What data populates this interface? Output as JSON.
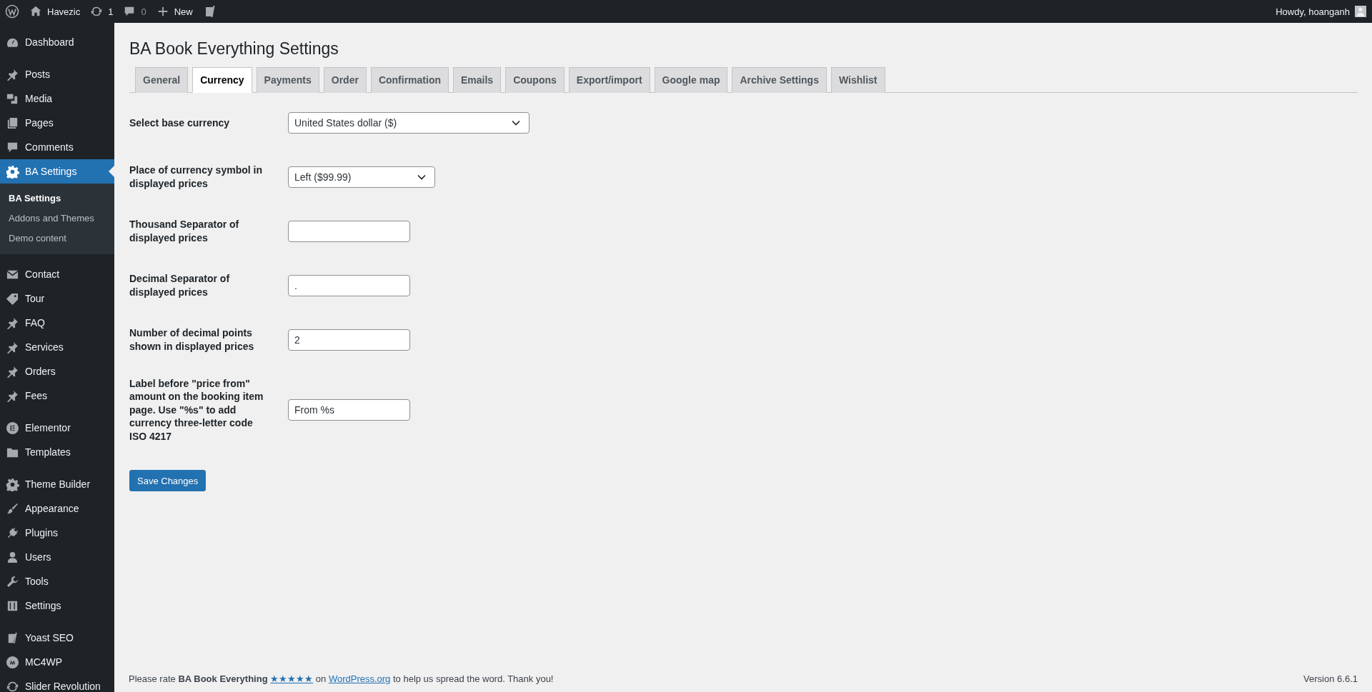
{
  "admin_bar": {
    "site_name": "Havezic",
    "updates": "1",
    "comments": "0",
    "new_label": "New",
    "greeting": "Howdy, hoanganh"
  },
  "sidebar": {
    "groups": [
      [
        {
          "label": "Dashboard",
          "selected": false
        }
      ],
      [
        {
          "label": "Posts",
          "selected": false
        },
        {
          "label": "Media",
          "selected": false
        },
        {
          "label": "Pages",
          "selected": false
        },
        {
          "label": "Comments",
          "selected": false
        },
        {
          "label": "BA Settings",
          "selected": true,
          "children": [
            {
              "label": "BA Settings",
              "selected": true
            },
            {
              "label": "Addons and Themes",
              "selected": false
            },
            {
              "label": "Demo content",
              "selected": false
            }
          ]
        }
      ],
      [
        {
          "label": "Contact",
          "selected": false
        },
        {
          "label": "Tour",
          "selected": false
        },
        {
          "label": "FAQ",
          "selected": false
        },
        {
          "label": "Services",
          "selected": false
        },
        {
          "label": "Orders",
          "selected": false
        },
        {
          "label": "Fees",
          "selected": false
        }
      ],
      [
        {
          "label": "Elementor",
          "selected": false
        },
        {
          "label": "Templates",
          "selected": false
        }
      ],
      [
        {
          "label": "Theme Builder",
          "selected": false
        },
        {
          "label": "Appearance",
          "selected": false
        },
        {
          "label": "Plugins",
          "selected": false
        },
        {
          "label": "Users",
          "selected": false
        },
        {
          "label": "Tools",
          "selected": false
        },
        {
          "label": "Settings",
          "selected": false
        }
      ],
      [
        {
          "label": "Yoast SEO",
          "selected": false
        },
        {
          "label": "MC4WP",
          "selected": false
        },
        {
          "label": "Slider Revolution",
          "selected": false
        }
      ]
    ]
  },
  "page": {
    "title": "BA Book Everything Settings",
    "tabs": [
      {
        "label": "General",
        "selected": false
      },
      {
        "label": "Currency",
        "selected": true
      },
      {
        "label": "Payments",
        "selected": false
      },
      {
        "label": "Order",
        "selected": false
      },
      {
        "label": "Confirmation",
        "selected": false
      },
      {
        "label": "Emails",
        "selected": false
      },
      {
        "label": "Coupons",
        "selected": false
      },
      {
        "label": "Export/import",
        "selected": false
      },
      {
        "label": "Google map",
        "selected": false
      },
      {
        "label": "Archive Settings",
        "selected": false
      },
      {
        "label": "Wishlist",
        "selected": false
      }
    ],
    "fields": [
      {
        "kind": "select",
        "label": "Select base currency",
        "value": "United States dollar ($)"
      },
      {
        "kind": "select",
        "label": "Place of currency symbol in displayed prices",
        "value": "Left ($99.99)"
      },
      {
        "kind": "text",
        "label": "Thousand Separator of displayed prices"
      },
      {
        "kind": "text",
        "label": "Decimal Separator of displayed prices",
        "value": "."
      },
      {
        "kind": "text",
        "label": "Number of decimal points shown in displayed prices",
        "value": "2"
      },
      {
        "kind": "text",
        "label": "Label before \"price from\" amount on the booking item page. Use \"%s\" to add currency three-letter code ISO 4217",
        "value": "From %s"
      }
    ],
    "save_button": "Save Changes"
  },
  "footer": {
    "parts": [
      {
        "kind": "text",
        "text": "Please rate "
      },
      {
        "kind": "bold",
        "text": "BA Book Everything "
      },
      {
        "kind": "link",
        "text": "★★★★★"
      },
      {
        "kind": "text",
        "text": " on "
      },
      {
        "kind": "link",
        "text": "WordPress.org"
      },
      {
        "kind": "text",
        "text": " to help us spread the word. Thank you!"
      }
    ],
    "version": "Version 6.6.1"
  }
}
